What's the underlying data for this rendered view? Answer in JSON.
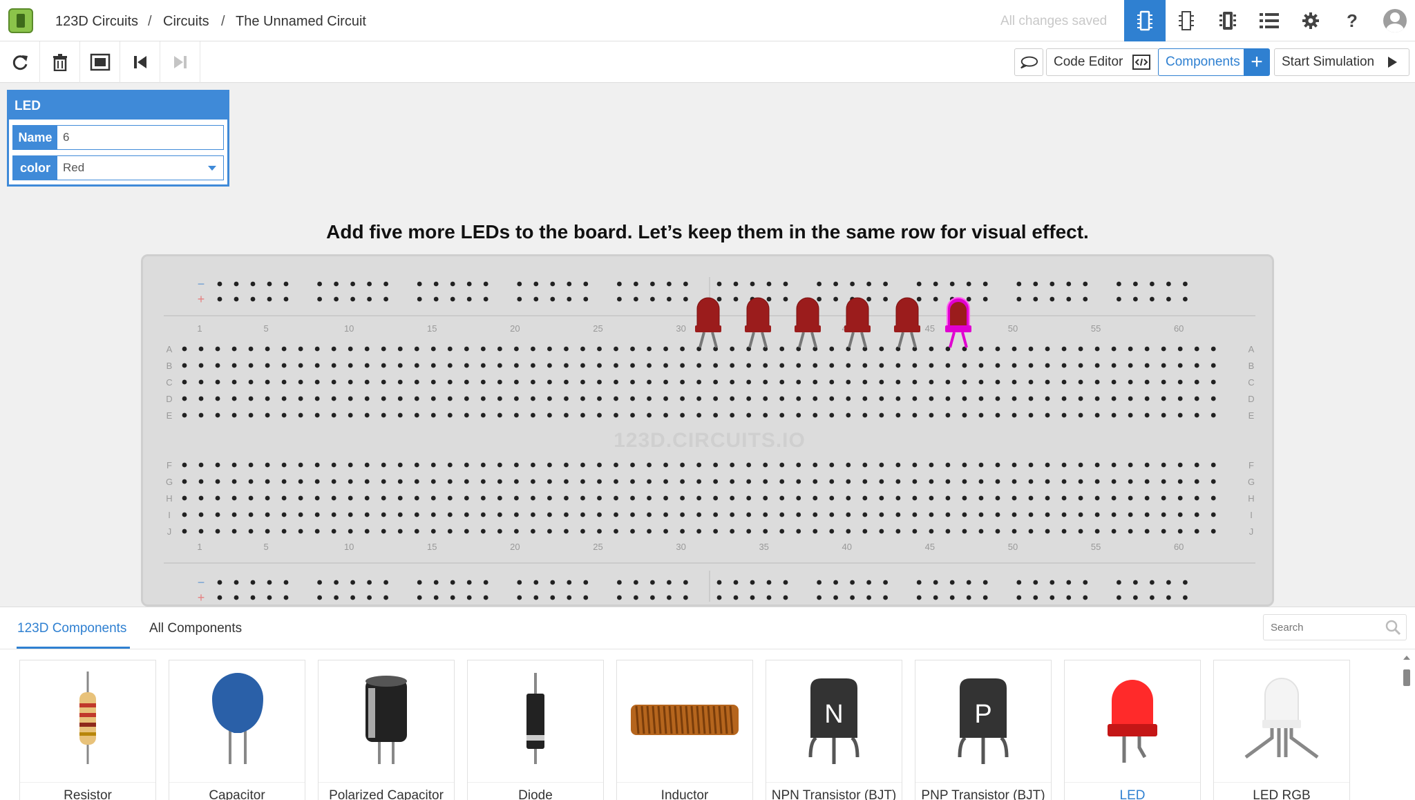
{
  "header": {
    "breadcrumbs": [
      "123D Circuits",
      "Circuits",
      "The Unnamed Circuit"
    ],
    "separator": "/",
    "save_status": "All changes saved",
    "view_buttons": [
      "breadboard-view-icon",
      "schematic-view-icon",
      "pcb-view-icon",
      "component-list-icon"
    ],
    "settings_icon": "gear-icon",
    "help_label": "?",
    "accent_color": "#2f80d1"
  },
  "toolbar": {
    "tools": [
      "rotate-icon",
      "delete-icon",
      "fit-to-screen-icon",
      "step-back-icon",
      "step-forward-icon"
    ],
    "code_editor_label": "Code Editor",
    "components_label": "Components",
    "start_simulation_label": "Start Simulation"
  },
  "inspector": {
    "title": "LED",
    "name_label": "Name",
    "name_value": "6",
    "color_label": "color",
    "color_value": "Red"
  },
  "instruction": "Add five more LEDs to the board. Let’s keep them in the same row for visual effect.",
  "breadboard": {
    "watermark": "123D.CIRCUITS.IO",
    "row_labels_top": [
      "A",
      "B",
      "C",
      "D",
      "E"
    ],
    "row_labels_bottom": [
      "F",
      "G",
      "H",
      "I",
      "J"
    ],
    "column_numbers": [
      "1",
      "5",
      "10",
      "15",
      "20",
      "25",
      "30",
      "35",
      "40",
      "45",
      "50",
      "55",
      "60"
    ],
    "rail_minus": "−",
    "rail_plus": "+",
    "led_count": 6,
    "led_color": "#9b1c1c",
    "selected_led_color": "#e000d0"
  },
  "panel": {
    "tabs": [
      "123D Components",
      "All Components"
    ],
    "search_placeholder": "Search",
    "components": [
      "Resistor",
      "Capacitor",
      "Polarized Capacitor",
      "Diode",
      "Inductor",
      "NPN Transistor (BJT)",
      "PNP Transistor (BJT)",
      "LED",
      "LED RGB"
    ],
    "selected": "LED",
    "npn_letter": "N",
    "pnp_letter": "P"
  }
}
